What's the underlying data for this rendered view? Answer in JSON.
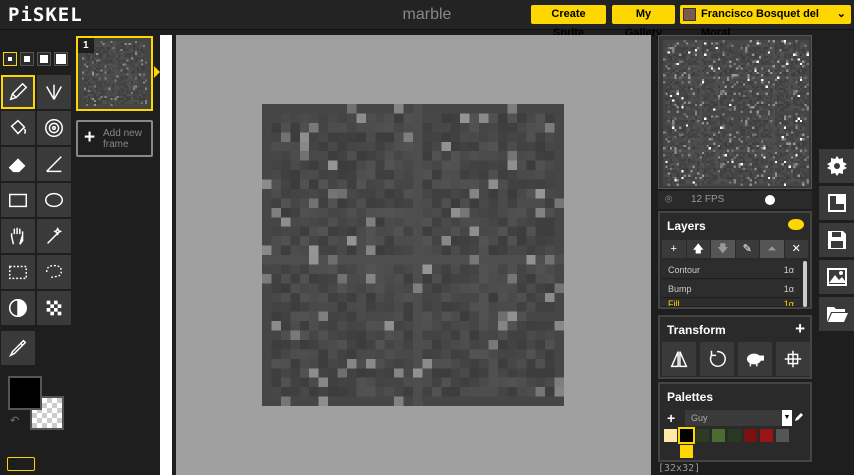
{
  "app": {
    "logo": "PiSKEL",
    "document_title": "marble"
  },
  "header": {
    "create_label": "Create Sprite",
    "gallery_label": "My Gallery",
    "user_name": "Francisco Bosquet del Moral"
  },
  "tools": {
    "pen_sizes": [
      1,
      2,
      3,
      4
    ],
    "selected_pen_size": 1,
    "items": [
      {
        "id": "pen",
        "icon": "pencil-icon",
        "selected": true
      },
      {
        "id": "mirror-pen",
        "icon": "vertical-mirror-pen-icon"
      },
      {
        "id": "paint-bucket",
        "icon": "paint-bucket-icon"
      },
      {
        "id": "paint-all-same-color",
        "icon": "paint-same-color-icon"
      },
      {
        "id": "eraser",
        "icon": "eraser-icon"
      },
      {
        "id": "stroke",
        "icon": "stroke-line-icon"
      },
      {
        "id": "rectangle",
        "icon": "rectangle-icon"
      },
      {
        "id": "circle",
        "icon": "circle-icon"
      },
      {
        "id": "move",
        "icon": "hand-move-icon"
      },
      {
        "id": "shape-select",
        "icon": "magic-wand-icon"
      },
      {
        "id": "rectangle-select",
        "icon": "rectangle-select-icon"
      },
      {
        "id": "lasso-select",
        "icon": "lasso-select-icon"
      },
      {
        "id": "lighten",
        "icon": "lighten-icon"
      },
      {
        "id": "dithering",
        "icon": "dithering-icon"
      },
      {
        "id": "color-picker",
        "icon": "eyedropper-icon"
      }
    ],
    "primary_color": "#000000",
    "secondary_color": "transparent"
  },
  "frames": {
    "items": [
      {
        "number": "1",
        "selected": true
      }
    ],
    "add_label": "Add new frame"
  },
  "preview": {
    "fps_label": "12 FPS"
  },
  "layers": {
    "title": "Layers",
    "tool_icons": [
      "add-layer-icon",
      "move-layer-up-icon",
      "move-layer-down-icon",
      "edit-layer-icon",
      "merge-layer-icon",
      "delete-layer-icon"
    ],
    "items": [
      {
        "name": "Contour",
        "opacity": "1α",
        "selected": false
      },
      {
        "name": "Bump",
        "opacity": "1α",
        "selected": false
      },
      {
        "name": "Fill",
        "opacity": "1α",
        "selected": true
      }
    ]
  },
  "transform": {
    "title": "Transform",
    "buttons": [
      {
        "id": "flip",
        "icon": "flip-horizontal-icon"
      },
      {
        "id": "rotate",
        "icon": "rotate-icon"
      },
      {
        "id": "clone",
        "icon": "sheep-clone-icon"
      },
      {
        "id": "center",
        "icon": "align-center-icon"
      }
    ]
  },
  "palettes": {
    "title": "Palettes",
    "selected": "Guy",
    "colors": [
      "#ffe9a8",
      "#000000",
      "#2d3b23",
      "#4b6b30",
      "#2a3a22",
      "#7a1010",
      "#9a1414",
      "#555555",
      "#2a2a2a",
      "#ffd700"
    ]
  },
  "status": {
    "dimensions": "[32x32]"
  },
  "side_actions": [
    {
      "id": "settings",
      "icon": "gear-icon"
    },
    {
      "id": "resize",
      "icon": "resize-icon"
    },
    {
      "id": "save",
      "icon": "floppy-disk-icon"
    },
    {
      "id": "export",
      "icon": "image-export-icon"
    },
    {
      "id": "import",
      "icon": "folder-open-icon"
    }
  ]
}
